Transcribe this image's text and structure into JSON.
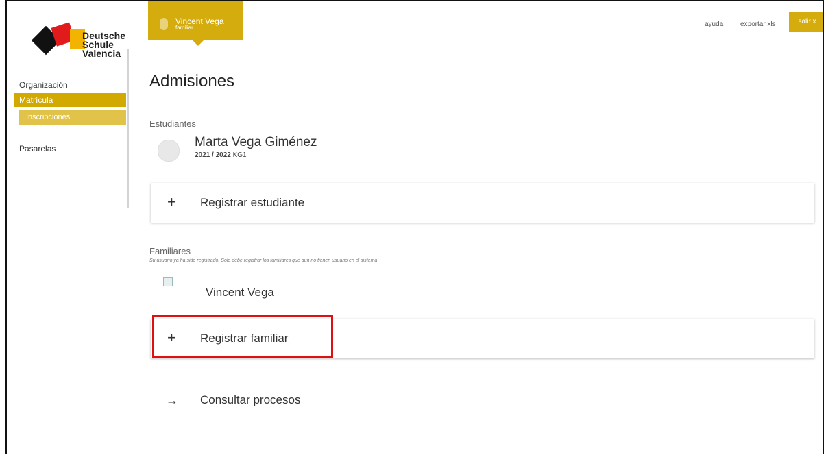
{
  "brand": {
    "logo_lines": [
      "Deutsche",
      "Schule",
      "Valencia"
    ]
  },
  "sidebar": {
    "items": [
      {
        "label": "Organización"
      },
      {
        "label": "Matrícula"
      },
      {
        "label": "Inscripciones"
      },
      {
        "label": "Pasarelas"
      }
    ]
  },
  "user": {
    "name": "Vincent Vega",
    "role": "familiar"
  },
  "top_menu": {
    "ayuda": "ayuda",
    "exportar": "exportar xls",
    "salir": "salir x"
  },
  "page": {
    "title": "Admisiones"
  },
  "estudiantes": {
    "label": "Estudiantes",
    "student": {
      "name": "Marta Vega Giménez",
      "year": "2021 / 2022",
      "grade": "KG1"
    },
    "register_label": "Registrar estudiante",
    "register_icon": "+"
  },
  "familiares": {
    "label": "Familiares",
    "note": "Su usuario ya ha sido registrado. Solo debe registrar los familiares que aun no tienen usuario en el sistema",
    "member_name": "Vincent Vega",
    "register_label": "Registrar familiar",
    "register_icon": "+"
  },
  "procesos": {
    "icon": "→",
    "label": "Consultar procesos"
  },
  "colors": {
    "accent": "#d4ac0d",
    "highlight": "#dd1111"
  }
}
